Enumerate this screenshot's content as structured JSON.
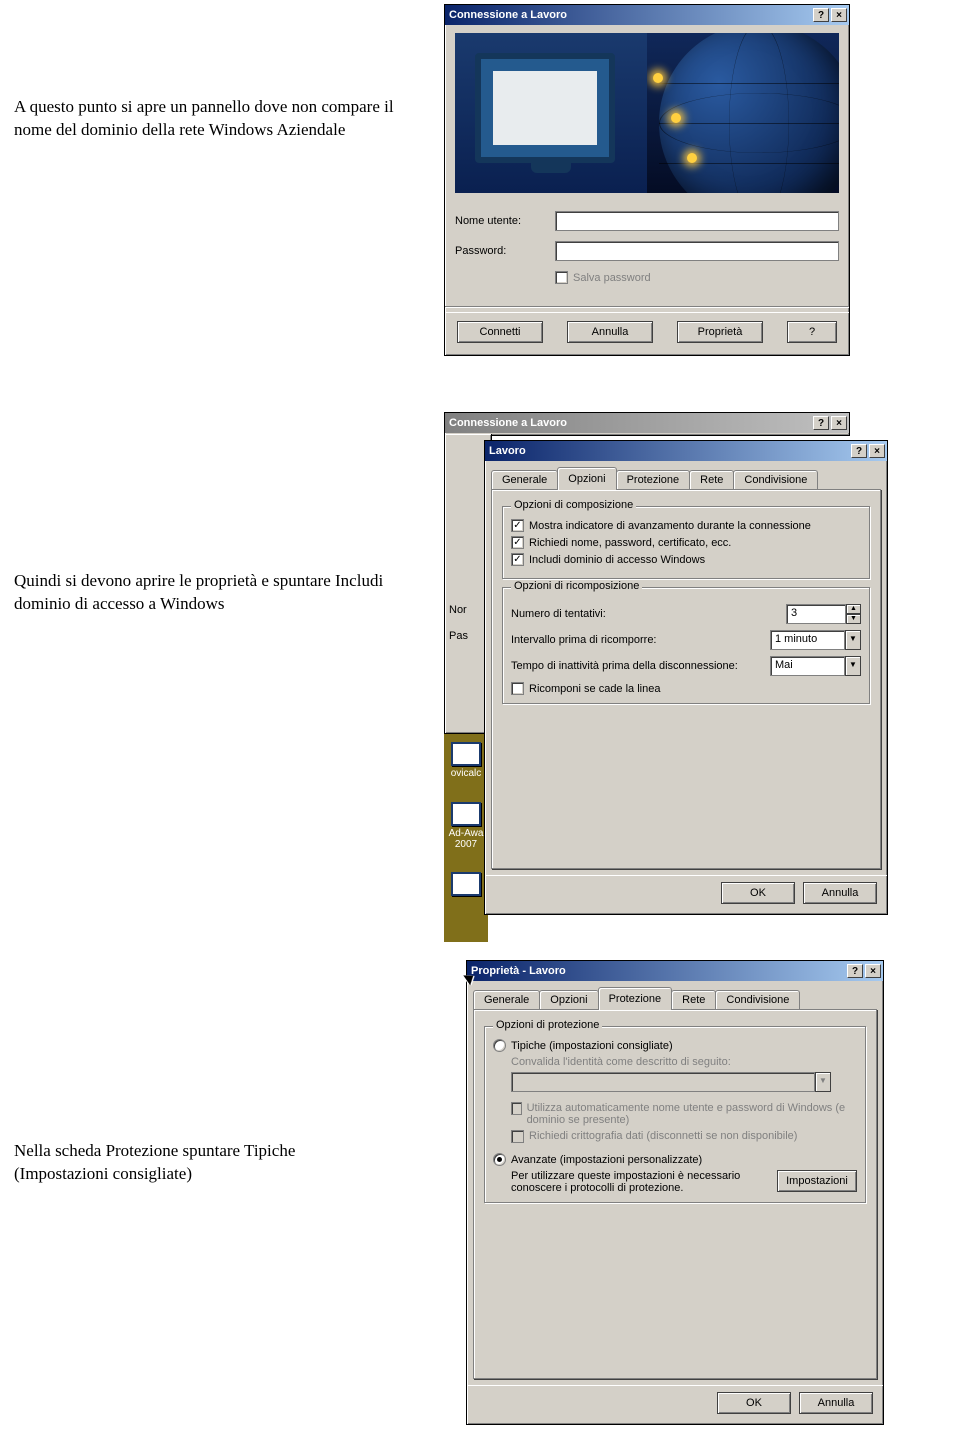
{
  "doc": {
    "para1": "A questo punto si apre un pannello dove non compare il nome del dominio della rete Windows Aziendale",
    "para2": "Quindi si devono aprire le proprietà e spuntare Includi dominio di accesso a Windows",
    "para3": "Nella scheda Protezione spuntare Tipiche (Impostazioni consigliate)"
  },
  "dialog1": {
    "title": "Connessione a Lavoro",
    "username_label": "Nome utente:",
    "username_value": "",
    "password_label": "Password:",
    "password_value": "",
    "save_pwd_label": "Salva password",
    "btn_connect": "Connetti",
    "btn_cancel": "Annulla",
    "btn_properties": "Proprietà",
    "btn_help": "?"
  },
  "dialog2_back": {
    "title": "Connessione a Lavoro",
    "label_nor": "Nor",
    "label_pas": "Pas"
  },
  "dialog2": {
    "title": "Lavoro",
    "tabs": [
      "Generale",
      "Opzioni",
      "Protezione",
      "Rete",
      "Condivisione"
    ],
    "active_tab": "Opzioni",
    "group_comp": "Opzioni di composizione",
    "chk_progress": "Mostra indicatore di avanzamento durante la connessione",
    "chk_prompt": "Richiedi nome, password, certificato, ecc.",
    "chk_domain": "Includi dominio di accesso Windows",
    "group_redial": "Opzioni di ricomposizione",
    "lbl_attempts": "Numero di tentativi:",
    "val_attempts": "3",
    "lbl_interval": "Intervallo prima di ricomporre:",
    "val_interval": "1 minuto",
    "lbl_idle": "Tempo di inattività prima della disconnessione:",
    "val_idle": "Mai",
    "chk_redial_drop": "Ricomponi se cade la linea",
    "btn_ok": "OK",
    "btn_cancel": "Annulla"
  },
  "desktop": {
    "icon1": "ovicalc",
    "icon2_line1": "Ad-Awa",
    "icon2_line2": "2007"
  },
  "dialog3": {
    "title": "Proprietà - Lavoro",
    "tabs": [
      "Generale",
      "Opzioni",
      "Protezione",
      "Rete",
      "Condivisione"
    ],
    "active_tab": "Protezione",
    "group_sec": "Opzioni di protezione",
    "rad_typical": "Tipiche (impostazioni consigliate)",
    "lbl_validate": "Convalida l'identità come descritto di seguito:",
    "chk_auto": "Utilizza automaticamente nome utente e password di Windows (e dominio se presente)",
    "chk_encrypt": "Richiedi crittografia dati (disconnetti se non disponibile)",
    "rad_advanced": "Avanzate (impostazioni personalizzate)",
    "lbl_adv_hint": "Per utilizzare queste impostazioni è necessario conoscere i protocolli di protezione.",
    "btn_settings": "Impostazioni",
    "btn_ok": "OK",
    "btn_cancel": "Annulla"
  }
}
